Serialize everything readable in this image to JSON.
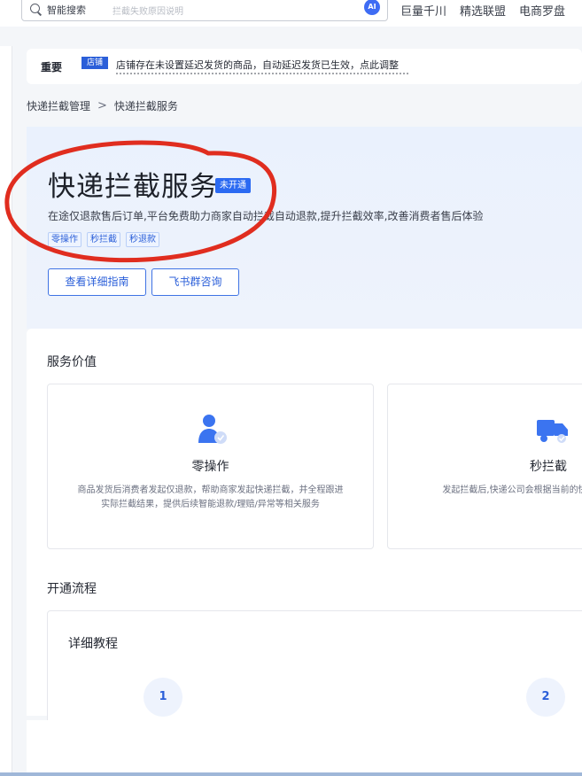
{
  "topbar": {
    "search_label": "智能搜索",
    "search_placeholder": "拦截失败原因说明",
    "ai_badge": "AI",
    "links": [
      "巨量千川",
      "精选联盟",
      "电商罗盘"
    ]
  },
  "notice": {
    "label": "重要",
    "tag": "店铺",
    "text": "店铺存在未设置延迟发货的商品，自动延迟发货已生效，点此调整"
  },
  "breadcrumb": {
    "parent": "快递拦截管理",
    "separator": ">",
    "current": "快递拦截服务"
  },
  "hero": {
    "title": "快递拦截服务",
    "status_badge": "未开通",
    "description": "在途仅退款售后订单,平台免费助力商家自动拦截自动退款,提升拦截效率,改善消费者售后体验",
    "tags": [
      "零操作",
      "秒拦截",
      "秒退款"
    ],
    "buttons": {
      "guide": "查看详细指南",
      "consult": "飞书群咨询"
    },
    "annotation_color": "#e02d1f"
  },
  "service_value": {
    "title": "服务价值",
    "cards": [
      {
        "title": "零操作",
        "icon": "user-shield-icon",
        "description": "商品发货后消费者发起仅退款，帮助商家发起快递拦截，并全程跟进实际拦截结果，提供后续智能退款/理赔/异常等相关服务"
      },
      {
        "title": "秒拦截",
        "icon": "truck-icon",
        "description": "发起拦截后,快递公司会根据当前的快递拦截结果"
      }
    ]
  },
  "onboarding": {
    "title": "开通流程",
    "tutorial_title": "详细教程",
    "steps": [
      "1",
      "2"
    ]
  },
  "colors": {
    "accent": "#2b6af2",
    "hero_bg": "#eaf1fd",
    "annotation": "#e02d1f"
  }
}
